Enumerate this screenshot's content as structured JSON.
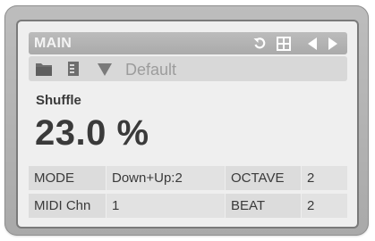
{
  "header": {
    "title": "MAIN"
  },
  "preset": {
    "name": "Default"
  },
  "parameter": {
    "name": "Shuffle",
    "value": "23.0 %"
  },
  "settings": {
    "mode_label": "MODE",
    "mode_value": "Down+Up:2",
    "octave_label": "OCTAVE",
    "octave_value": "2",
    "midi_label": "MIDI Chn",
    "midi_value": "1",
    "beat_label": "BEAT",
    "beat_value": "2"
  },
  "icons": {
    "undo": "undo-icon",
    "grid": "grid-icon",
    "prev": "arrow-left-icon",
    "next": "arrow-right-icon",
    "folder": "folder-icon",
    "save": "save-icon",
    "dropdown": "triangle-down-icon"
  },
  "colors": {
    "panel_bg": "#efefef",
    "title_bar": "#b4b4b4",
    "text": "#3a3a3a",
    "preset_text": "#9c9c9c"
  }
}
